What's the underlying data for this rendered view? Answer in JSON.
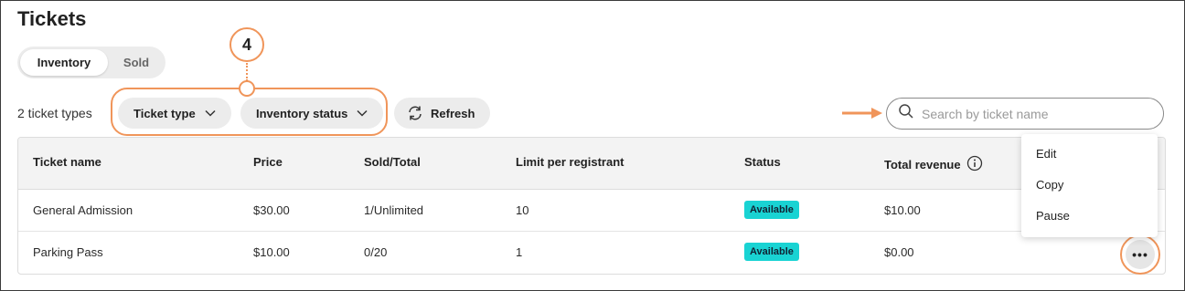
{
  "page": {
    "title": "Tickets"
  },
  "tabs": [
    {
      "label": "Inventory",
      "active": true
    },
    {
      "label": "Sold",
      "active": false
    }
  ],
  "toolbar": {
    "count_label": "2 ticket types",
    "ticket_type_label": "Ticket type",
    "inventory_status_label": "Inventory status",
    "refresh_label": "Refresh",
    "annotation_number": "4"
  },
  "search": {
    "placeholder": "Search by ticket name",
    "value": ""
  },
  "table": {
    "columns": [
      "Ticket name",
      "Price",
      "Sold/Total",
      "Limit per registrant",
      "Status",
      "Total revenue"
    ],
    "rows": [
      {
        "name": "General Admission",
        "price": "$30.00",
        "sold_total": "1/Unlimited",
        "limit": "10",
        "status": "Available",
        "revenue": "$10.00"
      },
      {
        "name": "Parking Pass",
        "price": "$10.00",
        "sold_total": "0/20",
        "limit": "1",
        "status": "Available",
        "revenue": "$0.00"
      }
    ]
  },
  "row_menu": {
    "items": [
      "Edit",
      "Copy",
      "Pause"
    ]
  },
  "more_button_label": "•••",
  "colors": {
    "accent_orange": "#f0955a",
    "status_available": "#19d3d3"
  },
  "icons": [
    "chevron-down-icon",
    "refresh-icon",
    "search-icon",
    "info-icon",
    "arrow-right-icon",
    "more-icon"
  ]
}
